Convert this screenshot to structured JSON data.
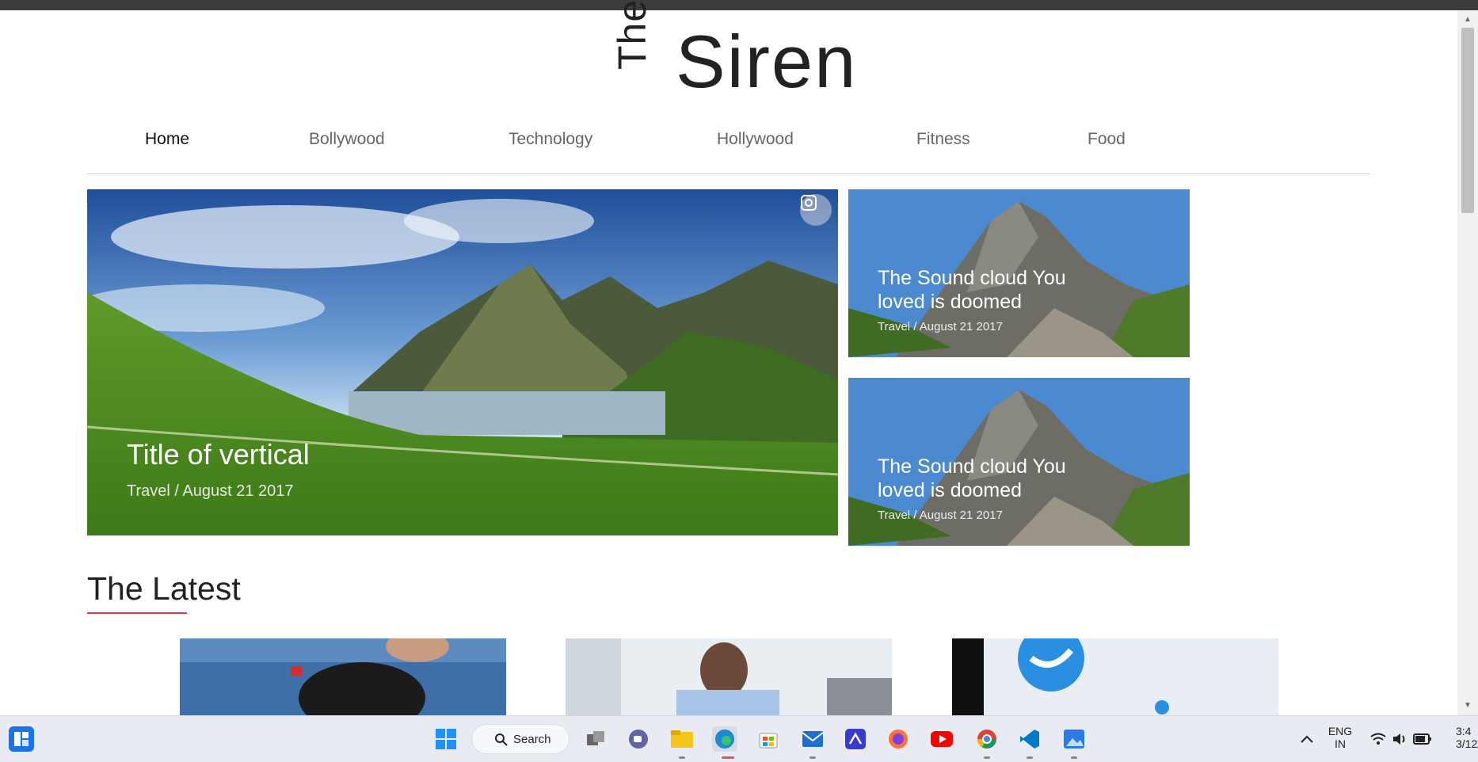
{
  "site": {
    "logo_the": "The",
    "logo_siren": "Siren"
  },
  "nav": {
    "items": [
      {
        "label": "Home",
        "active": true
      },
      {
        "label": "Bollywood",
        "active": false
      },
      {
        "label": "Technology",
        "active": false
      },
      {
        "label": "Hollywood",
        "active": false
      },
      {
        "label": "Fitness",
        "active": false
      },
      {
        "label": "Food",
        "active": false
      }
    ]
  },
  "hero": {
    "main": {
      "title": "Title of vertical",
      "meta": "Travel / August 21 2017"
    },
    "side": [
      {
        "title": "The Sound cloud You loved is doomed",
        "meta": "Travel / August 21 2017"
      },
      {
        "title": "The Sound cloud You loved is doomed",
        "meta": "Travel / August 21 2017"
      }
    ]
  },
  "latest": {
    "title": "The Latest"
  },
  "taskbar": {
    "search_label": "Search",
    "lang_line1": "ENG",
    "lang_line2": "IN",
    "time": "3:4",
    "date": "3/12/"
  },
  "colors": {
    "accent_underline": "#e03a3a",
    "nav_active": "#111111",
    "nav_inactive": "#666666"
  }
}
